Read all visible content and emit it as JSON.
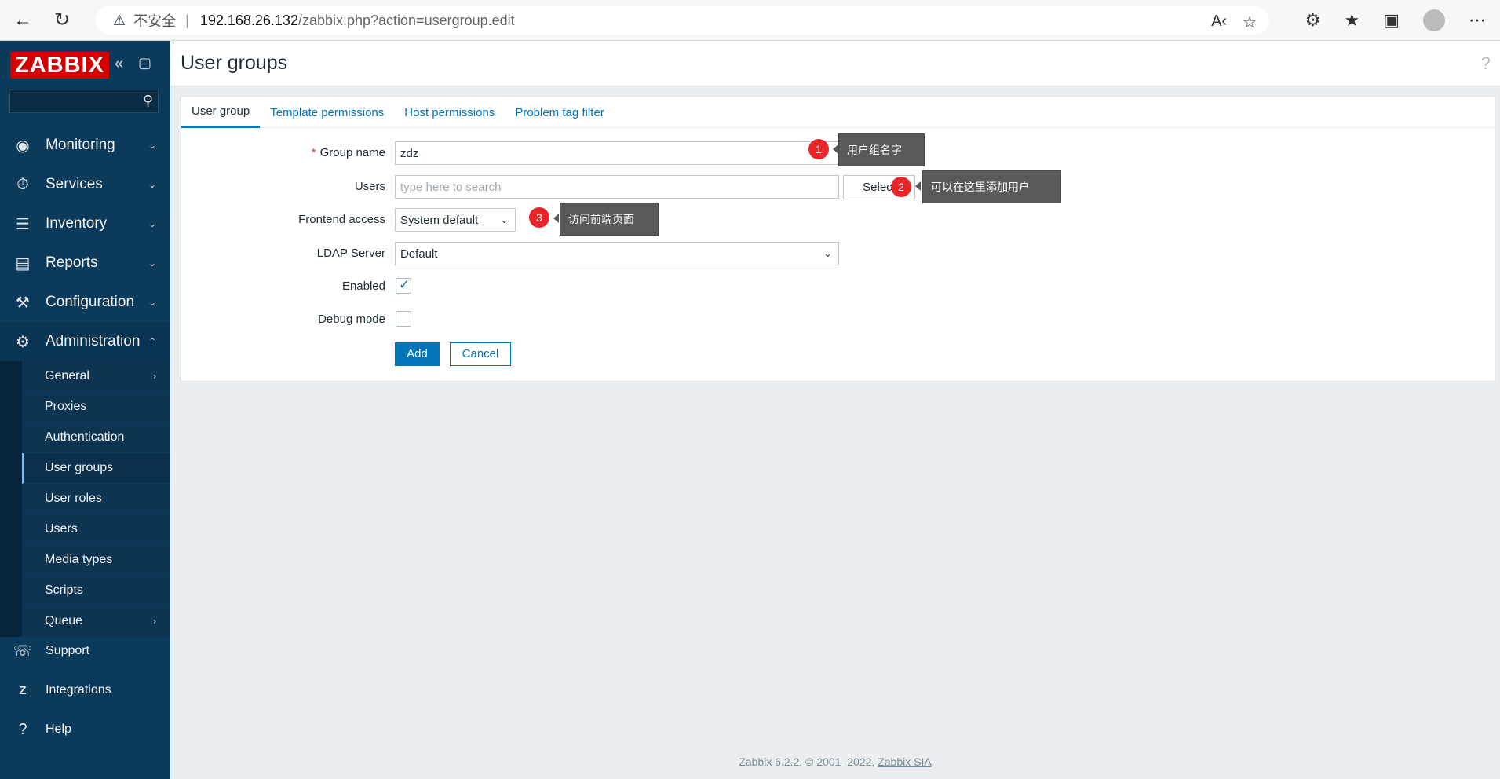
{
  "browser": {
    "back_icon": "back-arrow-icon",
    "refresh_icon": "refresh-icon",
    "warning_label": "不安全",
    "url_host": "192.168.26.132",
    "url_path": "/zabbix.php?action=usergroup.edit"
  },
  "sidebar": {
    "logo": "ZABBIX",
    "search_value": "",
    "menu": [
      {
        "label": "Monitoring",
        "icon": "eye-icon"
      },
      {
        "label": "Services",
        "icon": "timer-icon"
      },
      {
        "label": "Inventory",
        "icon": "list-icon"
      },
      {
        "label": "Reports",
        "icon": "chart-icon"
      },
      {
        "label": "Configuration",
        "icon": "wrench-icon"
      },
      {
        "label": "Administration",
        "icon": "gear-icon"
      }
    ],
    "submenu": [
      {
        "label": "General"
      },
      {
        "label": "Proxies"
      },
      {
        "label": "Authentication"
      },
      {
        "label": "User groups"
      },
      {
        "label": "User roles"
      },
      {
        "label": "Users"
      },
      {
        "label": "Media types"
      },
      {
        "label": "Scripts"
      },
      {
        "label": "Queue"
      }
    ],
    "bottom": [
      {
        "label": "Support",
        "icon": "headset-icon"
      },
      {
        "label": "Integrations",
        "icon": "z-icon"
      },
      {
        "label": "Help",
        "icon": "question-icon"
      }
    ]
  },
  "header": {
    "title": "User groups",
    "help": "?"
  },
  "tabs": [
    {
      "label": "User group"
    },
    {
      "label": "Template permissions"
    },
    {
      "label": "Host permissions"
    },
    {
      "label": "Problem tag filter"
    }
  ],
  "form": {
    "group_name_label": "Group name",
    "group_name_value": "zdz",
    "users_label": "Users",
    "users_placeholder": "type here to search",
    "select_button": "Select",
    "frontend_label": "Frontend access",
    "frontend_value": "System default",
    "ldap_label": "LDAP Server",
    "ldap_value": "Default",
    "enabled_label": "Enabled",
    "enabled_checked": true,
    "debug_label": "Debug mode",
    "debug_checked": false,
    "add_button": "Add",
    "cancel_button": "Cancel"
  },
  "annotations": [
    {
      "number": "1",
      "text": "用户组名字"
    },
    {
      "number": "2",
      "text": "可以在这里添加用户"
    },
    {
      "number": "3",
      "text": "访问前端页面"
    }
  ],
  "footer": {
    "text": "Zabbix 6.2.2. © 2001–2022,",
    "link": "Zabbix SIA"
  }
}
